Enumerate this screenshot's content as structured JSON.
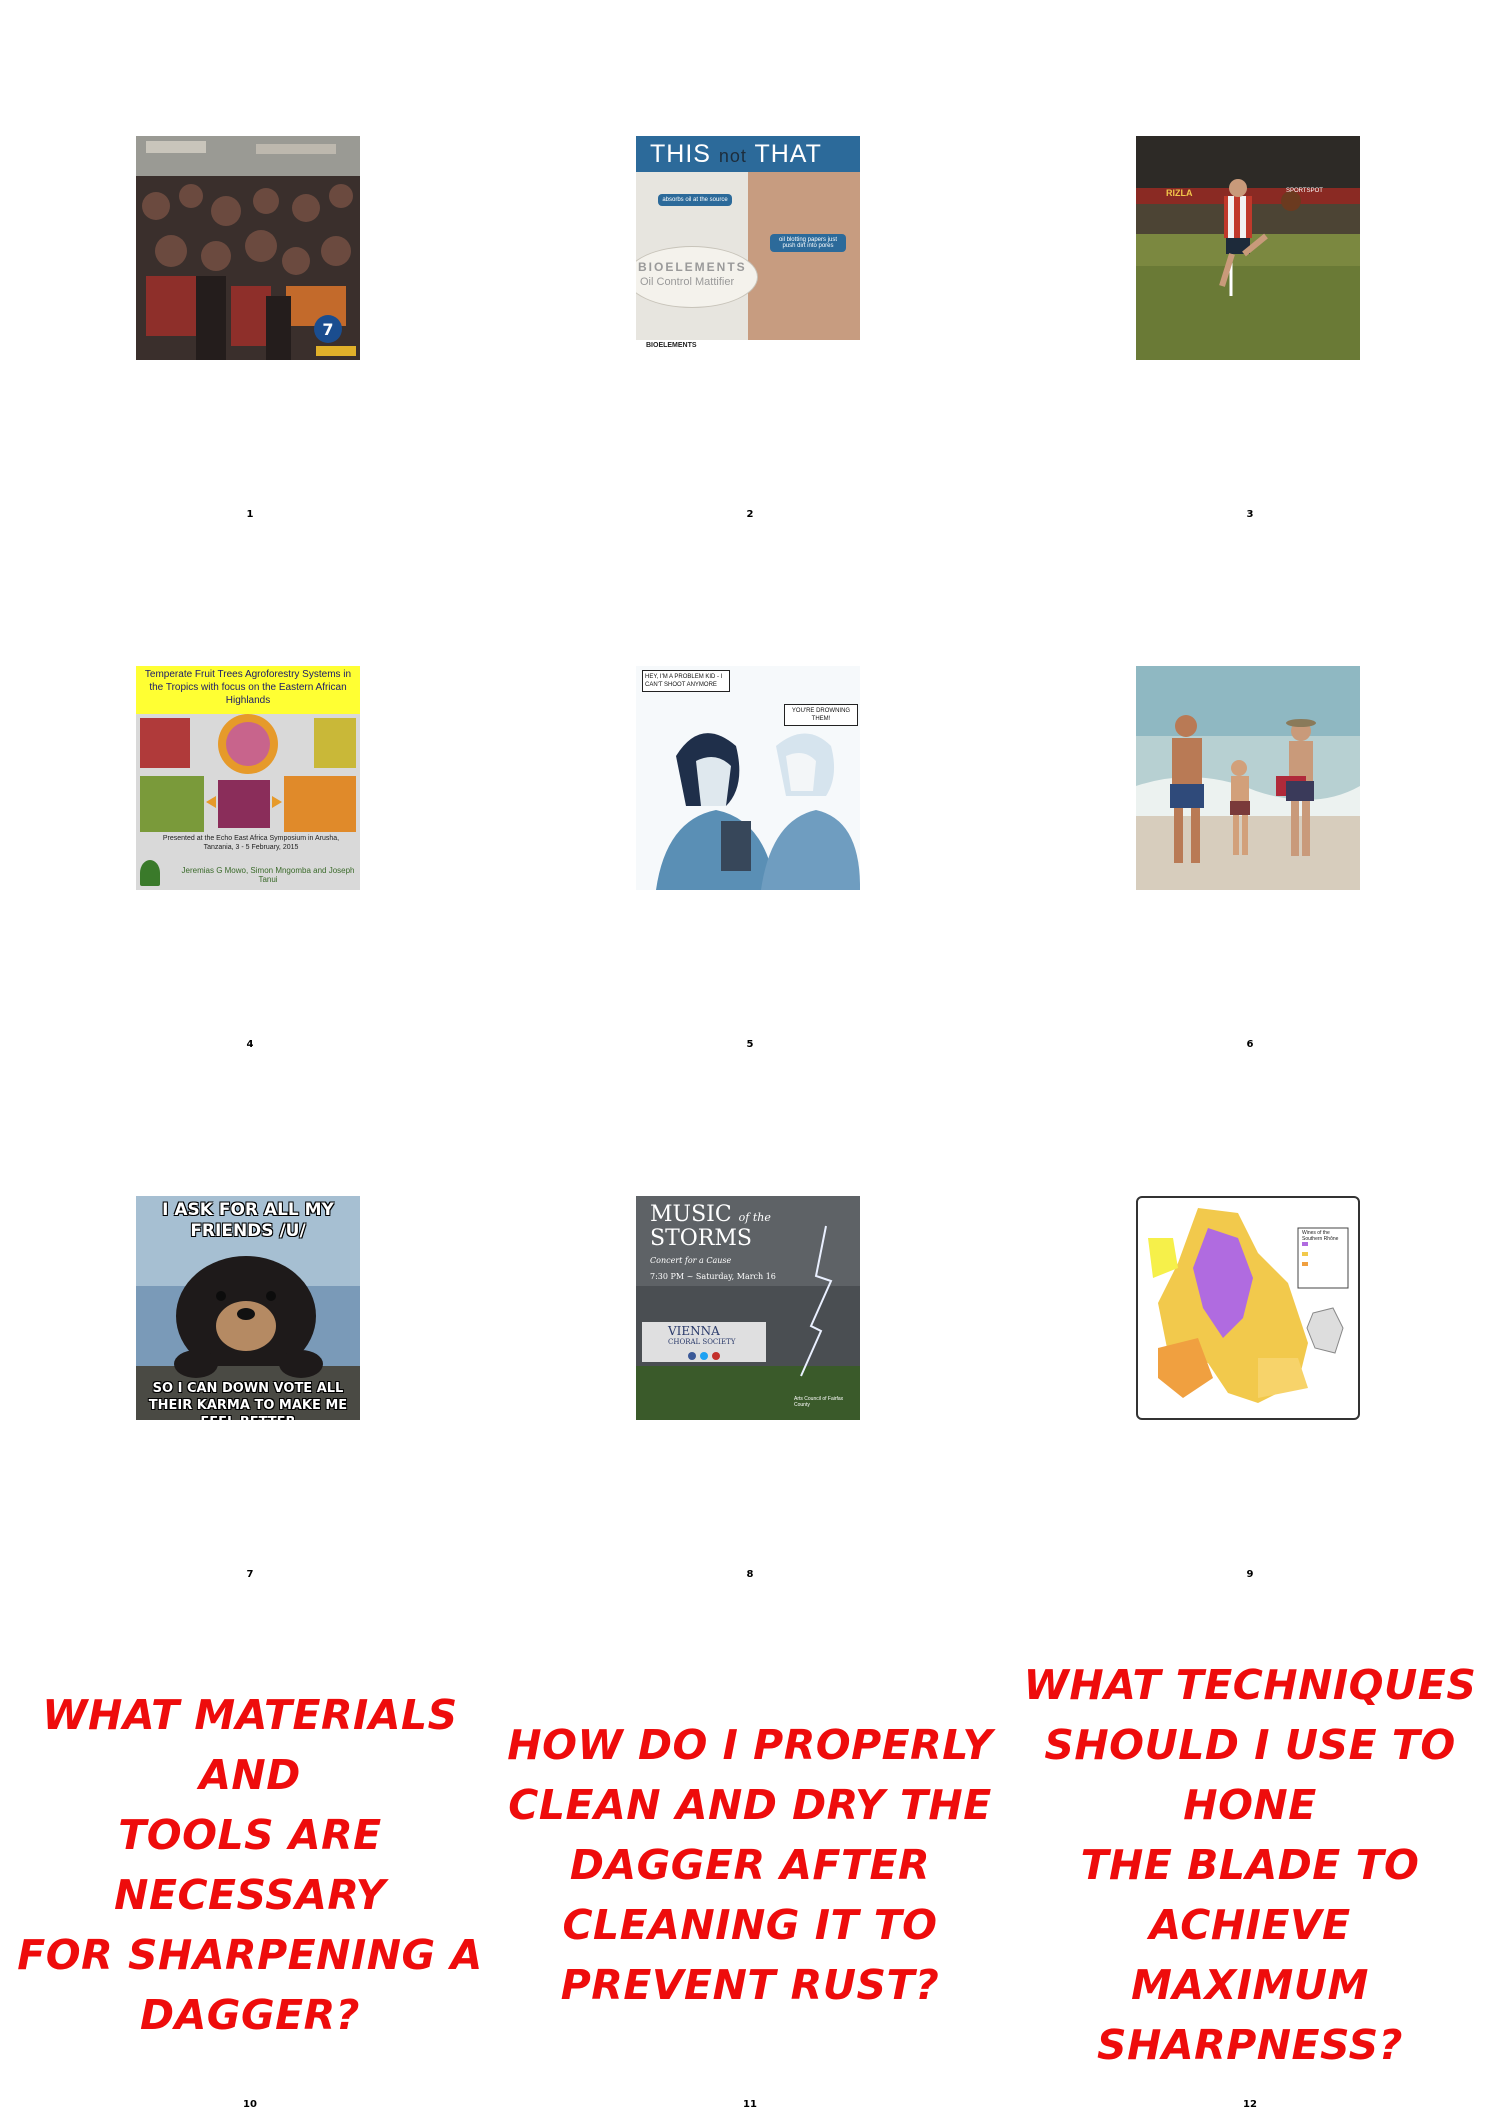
{
  "cells": [
    {
      "number": "1"
    },
    {
      "number": "2",
      "image_text": {
        "this": "THIS",
        "not": "not",
        "that": "THAT",
        "bubble1": "absorbs oil at the source",
        "bubble2": "oil blotting papers just push dirt into pores",
        "brand": "BIOELEMENTS",
        "product": "Oil Control Mattifier",
        "footer": "BIOELEMENTS"
      }
    },
    {
      "number": "3",
      "image_text": {
        "sign1": "RIZLA",
        "sign2": "SPORTSPOT"
      }
    },
    {
      "number": "4",
      "image_text": {
        "title": "Temperate Fruit Trees Agroforestry Systems in the Tropics with focus on the Eastern African Highlands",
        "presented": "Presented at the Echo East Africa Symposium in Arusha, Tanzania, 3 - 5 February, 2015",
        "authors": "Jeremias G Mowo, Simon Mngomba and Joseph Tanui"
      }
    },
    {
      "number": "5",
      "image_text": {
        "bubble1": "HEY, I'M A PROBLEM KID - I CAN'T SHOOT ANYMORE",
        "bubble2": "YOU'RE DROWNING THEM!"
      }
    },
    {
      "number": "6"
    },
    {
      "number": "7",
      "image_text": {
        "top": "I ASK FOR ALL MY FRIENDS /U/",
        "bottom": "SO I CAN DOWN VOTE ALL THEIR KARMA TO MAKE ME FEEL BETTER"
      }
    },
    {
      "number": "8",
      "image_text": {
        "title1": "MUSIC",
        "title_small": "of the",
        "title2": "STORMS",
        "subtitle": "Concert for a Cause",
        "date": "7:30 PM ~ Saturday, March 16",
        "org1": "VIENNA",
        "org2": "CHORAL SOCIETY",
        "footer": "Arts Council of Fairfax County"
      }
    },
    {
      "number": "9",
      "image_text": {
        "title": "Wines of the Southern Rhône"
      }
    },
    {
      "number": "10",
      "question": [
        "WHAT MATERIALS AND",
        "TOOLS ARE NECESSARY",
        "FOR SHARPENING A",
        "DAGGER?"
      ]
    },
    {
      "number": "11",
      "question": [
        "HOW DO I PROPERLY",
        "CLEAN AND DRY THE",
        "DAGGER AFTER",
        "CLEANING IT TO",
        "PREVENT RUST?"
      ]
    },
    {
      "number": "12",
      "question": [
        "WHAT TECHNIQUES",
        "SHOULD I USE TO HONE",
        "THE BLADE TO ACHIEVE",
        "MAXIMUM SHARPNESS?"
      ]
    }
  ],
  "colors": {
    "question_text": "#ee0c0c",
    "background": "#ffffff"
  }
}
